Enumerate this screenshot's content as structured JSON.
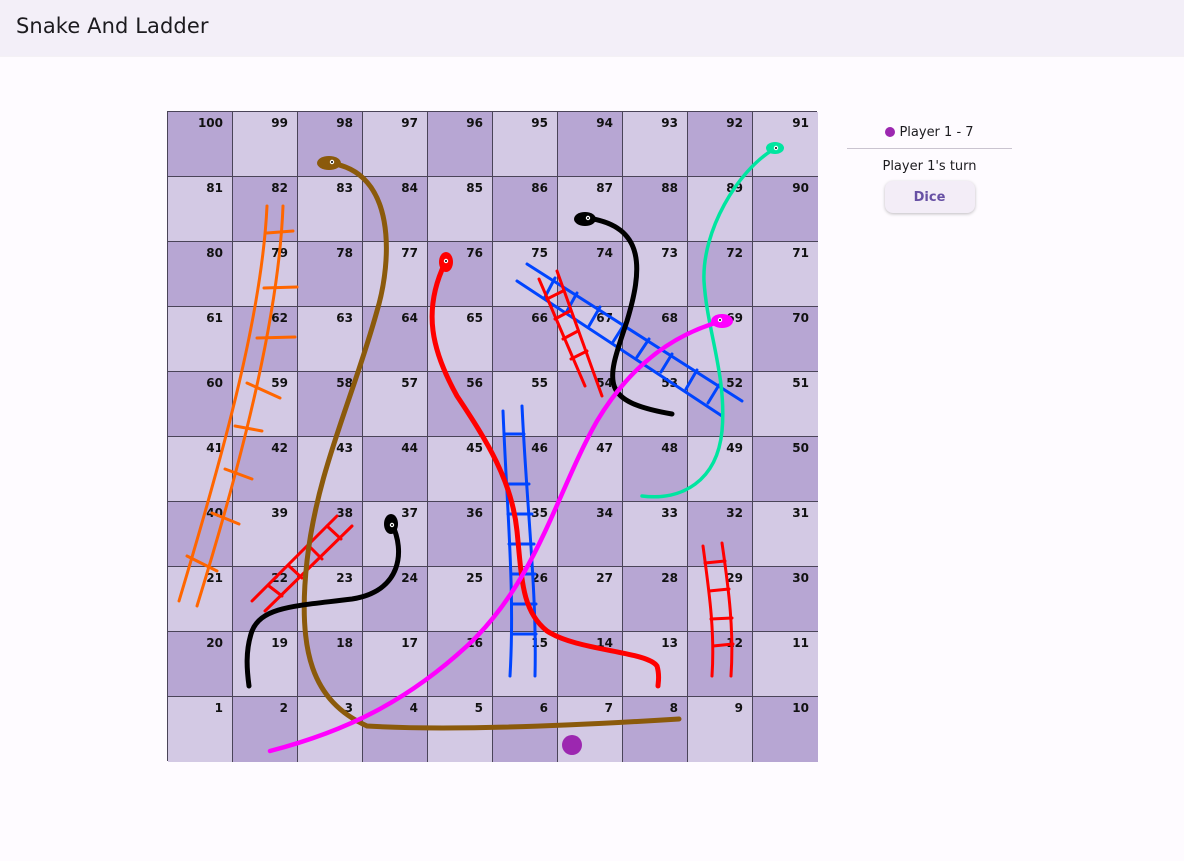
{
  "app": {
    "title": "Snake And Ladder"
  },
  "board": {
    "rows": [
      [
        100,
        99,
        98,
        97,
        96,
        95,
        94,
        93,
        92,
        91
      ],
      [
        81,
        82,
        83,
        84,
        85,
        86,
        87,
        88,
        89,
        90
      ],
      [
        80,
        79,
        78,
        77,
        76,
        75,
        74,
        73,
        72,
        71
      ],
      [
        61,
        62,
        63,
        64,
        65,
        66,
        67,
        68,
        69,
        70
      ],
      [
        60,
        59,
        58,
        57,
        56,
        55,
        54,
        53,
        52,
        51
      ],
      [
        41,
        42,
        43,
        44,
        45,
        46,
        47,
        48,
        49,
        50
      ],
      [
        40,
        39,
        38,
        37,
        36,
        35,
        34,
        33,
        32,
        31
      ],
      [
        21,
        22,
        23,
        24,
        25,
        26,
        27,
        28,
        29,
        30
      ],
      [
        20,
        19,
        18,
        17,
        16,
        15,
        14,
        13,
        12,
        11
      ],
      [
        1,
        2,
        3,
        4,
        5,
        6,
        7,
        8,
        9,
        10
      ]
    ],
    "colors": {
      "dark": "#b7a6d3",
      "light": "#d3c9e4"
    },
    "snakes": [
      {
        "color": "#8b5a0b",
        "from": 98,
        "to": 8
      },
      {
        "color": "#ff0000",
        "from": 76,
        "to": 13
      },
      {
        "color": "#000000",
        "from": 87,
        "to": 53
      },
      {
        "color": "#000000",
        "from": 37,
        "to": 19
      },
      {
        "color": "#00e5a0",
        "from": 91,
        "to": 48
      },
      {
        "color": "#ff00ff",
        "from": 69,
        "to": 2
      }
    ],
    "ladders": [
      {
        "color": "#ff6600",
        "from": 21,
        "to": 82
      },
      {
        "color": "#ff0000",
        "from": 22,
        "to": 38
      },
      {
        "color": "#0044ff",
        "from": 15,
        "to": 46
      },
      {
        "color": "#0044ff",
        "from": 52,
        "to": 75
      },
      {
        "color": "#ff0000",
        "from": 54,
        "to": 75
      },
      {
        "color": "#ff0000",
        "from": 12,
        "to": 29
      }
    ]
  },
  "player": {
    "label": "Player 1 - 7",
    "position": 7,
    "color": "#9c27b0",
    "turn_text": "Player 1's turn"
  },
  "controls": {
    "dice_label": "Dice"
  }
}
